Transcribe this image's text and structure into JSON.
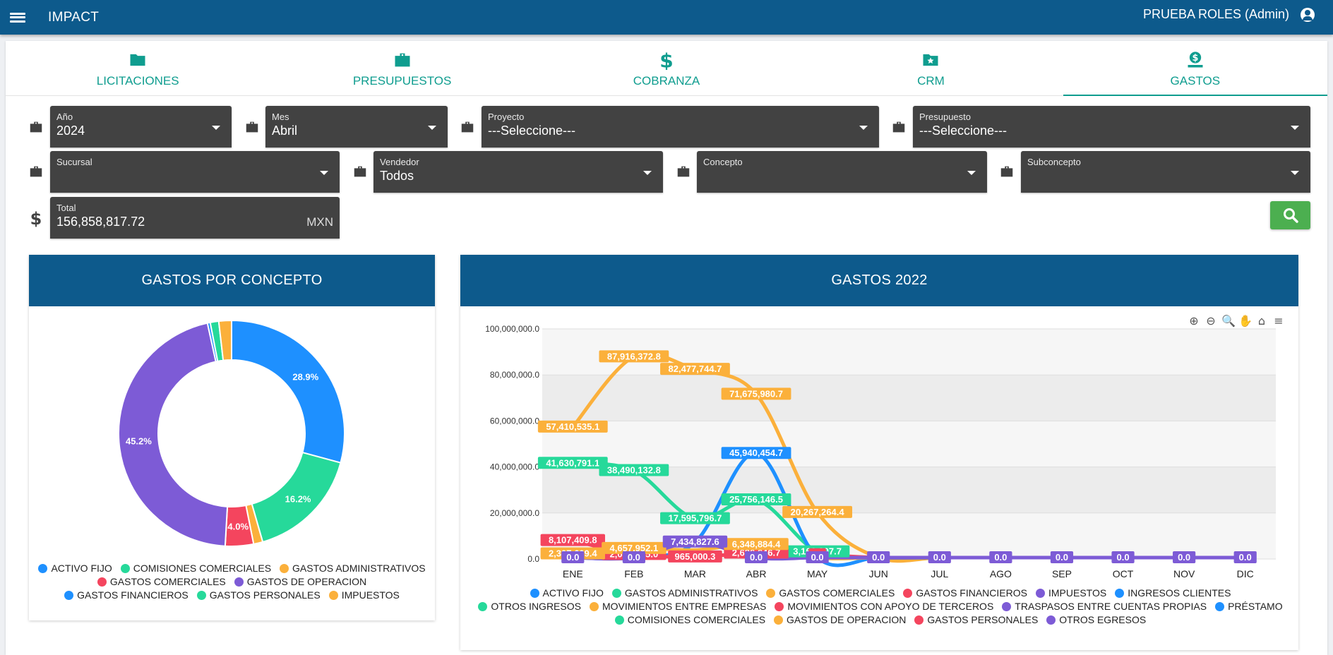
{
  "header": {
    "app_title": "IMPACT",
    "user": "PRUEBA ROLES (Admin)"
  },
  "tabs": [
    {
      "label": "LICITACIONES",
      "icon": "folder-icon"
    },
    {
      "label": "PRESUPUESTOS",
      "icon": "briefcase-icon"
    },
    {
      "label": "COBRANZA",
      "icon": "dollar-icon"
    },
    {
      "label": "CRM",
      "icon": "folder-star-icon"
    },
    {
      "label": "GASTOS",
      "icon": "hand-money-icon"
    }
  ],
  "filters": {
    "anio": {
      "label": "Año",
      "value": "2024"
    },
    "mes": {
      "label": "Mes",
      "value": "Abril"
    },
    "proyecto": {
      "label": "Proyecto",
      "value": "---Seleccione---"
    },
    "presupuesto": {
      "label": "Presupuesto",
      "value": "---Seleccione---"
    },
    "sucursal": {
      "label": "Sucursal",
      "value": ""
    },
    "vendedor": {
      "label": "Vendedor",
      "value": "Todos"
    },
    "concepto": {
      "label": "Concepto",
      "value": ""
    },
    "subconcepto": {
      "label": "Subconcepto",
      "value": ""
    },
    "total": {
      "label": "Total",
      "value": "156,858,817.72",
      "suffix": "MXN"
    }
  },
  "colors": {
    "header": "#0d5a8c",
    "accent": "#0f9d8f",
    "search": "#4caf50"
  },
  "donut": {
    "title": "GASTOS POR CONCEPTO",
    "legend": [
      {
        "name": "ACTIVO FIJO",
        "color": "#1e90ff"
      },
      {
        "name": "COMISIONES COMERCIALES",
        "color": "#26d99a"
      },
      {
        "name": "GASTOS ADMINISTRATIVOS",
        "color": "#fbb03b"
      },
      {
        "name": "GASTOS COMERCIALES",
        "color": "#f4455e"
      },
      {
        "name": "GASTOS DE OPERACION",
        "color": "#7d5bd6"
      },
      {
        "name": "GASTOS FINANCIEROS",
        "color": "#1e90ff"
      },
      {
        "name": "GASTOS PERSONALES",
        "color": "#26d99a"
      },
      {
        "name": "IMPUESTOS",
        "color": "#fbb03b"
      }
    ]
  },
  "line_chart": {
    "title": "GASTOS 2022",
    "toolbar": [
      "zoom-in-icon",
      "zoom-out-icon",
      "magnifier-icon",
      "pan-hand-icon",
      "home-icon",
      "menu-icon"
    ],
    "legend": [
      {
        "name": "ACTIVO FIJO",
        "color": "#1e90ff"
      },
      {
        "name": "GASTOS ADMINISTRATIVOS",
        "color": "#26d99a"
      },
      {
        "name": "GASTOS COMERCIALES",
        "color": "#fbb03b"
      },
      {
        "name": "GASTOS FINANCIEROS",
        "color": "#f4455e"
      },
      {
        "name": "IMPUESTOS",
        "color": "#7d5bd6"
      },
      {
        "name": "INGRESOS CLIENTES",
        "color": "#1e90ff"
      },
      {
        "name": "OTROS INGRESOS",
        "color": "#26d99a"
      },
      {
        "name": "MOVIMIENTOS ENTRE EMPRESAS",
        "color": "#fbb03b"
      },
      {
        "name": "MOVIMIENTOS CON APOYO DE TERCEROS",
        "color": "#f4455e"
      },
      {
        "name": "TRASPASOS ENTRE CUENTAS PROPIAS",
        "color": "#7d5bd6"
      },
      {
        "name": "PRÉSTAMO",
        "color": "#1e90ff"
      },
      {
        "name": "COMISIONES COMERCIALES",
        "color": "#26d99a"
      },
      {
        "name": "GASTOS DE OPERACION",
        "color": "#fbb03b"
      },
      {
        "name": "GASTOS PERSONALES",
        "color": "#f4455e"
      },
      {
        "name": "OTROS EGRESOS",
        "color": "#7d5bd6"
      }
    ]
  },
  "chart_data": [
    {
      "type": "pie",
      "title": "GASTOS POR CONCEPTO",
      "categories": [
        "ACTIVO FIJO",
        "COMISIONES COMERCIALES",
        "GASTOS ADMINISTRATIVOS",
        "GASTOS COMERCIALES",
        "GASTOS DE OPERACION",
        "GASTOS FINANCIEROS",
        "GASTOS PERSONALES",
        "IMPUESTOS"
      ],
      "values": [
        28.9,
        16.2,
        1.3,
        4.0,
        45.2,
        0.4,
        1.2,
        1.8
      ],
      "labels": [
        "28.9%",
        "16.2%",
        "",
        "4.0%",
        "45.2%",
        "",
        "",
        ""
      ],
      "colors": [
        "#1e90ff",
        "#26d99a",
        "#fbb03b",
        "#f4455e",
        "#7d5bd6",
        "#1e90ff",
        "#26d99a",
        "#fbb03b"
      ],
      "legend": "bottom"
    },
    {
      "type": "line",
      "title": "GASTOS 2022",
      "categories": [
        "ENE",
        "FEB",
        "MAR",
        "ABR",
        "MAY",
        "JUN",
        "JUL",
        "AGO",
        "SEP",
        "OCT",
        "NOV",
        "DIC"
      ],
      "ylim": [
        0,
        100000000
      ],
      "yticks": [
        "0.0",
        "20,000,000.0",
        "40,000,000.0",
        "60,000,000.0",
        "80,000,000.0",
        "100,000,000.0"
      ],
      "series": [
        {
          "name": "GASTOS DE OPERACION",
          "color": "#fbb03b",
          "values": [
            57410535.1,
            87916372.8,
            82477744.7,
            71675980.7,
            20267264.4,
            0,
            0,
            0,
            0,
            0,
            0,
            0
          ],
          "labels": [
            "57,410,535.1",
            "87,916,372.8",
            "82,477,744.7",
            "71,675,980.7",
            "20,267,264.4",
            "",
            "",
            "",
            "",
            "",
            "",
            ""
          ]
        },
        {
          "name": "COMISIONES COMERCIALES",
          "color": "#26d99a",
          "values": [
            41630791.1,
            38490132.8,
            17595796.7,
            25756146.5,
            3169297.7,
            0,
            0,
            0,
            0,
            0,
            0,
            0
          ],
          "labels": [
            "41,630,791.1",
            "38,490,132.8",
            "17,595,796.7",
            "25,756,146.5",
            "3,169,297.7",
            "",
            "",
            "",
            "",
            "",
            "",
            ""
          ]
        },
        {
          "name": "ACTIVO FIJO",
          "color": "#1e90ff",
          "values": [
            0,
            0,
            7300000,
            45940454.7,
            0,
            0,
            0,
            0,
            0,
            0,
            0,
            0
          ],
          "labels": [
            "",
            "",
            "",
            "45,940,454.7",
            "",
            "",
            "",
            "",
            "",
            "",
            "",
            ""
          ]
        },
        {
          "name": "GASTOS PERSONALES",
          "color": "#f4455e",
          "values": [
            8107409.8,
            2041785.0,
            965000,
            2626646.7,
            1900000,
            0,
            0,
            0,
            0,
            0,
            0,
            0
          ],
          "labels": [
            "8,107,409.8",
            "2,041,785.0",
            "965,000.3",
            "2,626,646.7",
            "19",
            "",
            "",
            "",
            "",
            "",
            "",
            ""
          ]
        },
        {
          "name": "GASTOS ADMINISTRATIVOS",
          "color": "#fbb03b",
          "values": [
            2300000,
            4657952.1,
            3900000,
            6348884.4,
            0,
            0,
            0,
            0,
            0,
            0,
            0,
            0
          ],
          "labels": [
            "2,307,609.4",
            "4,657,952.1",
            "",
            "6,348,884.4",
            "",
            "",
            "",
            "",
            "",
            "",
            "",
            ""
          ]
        },
        {
          "name": "IMPUESTOS",
          "color": "#7d5bd6",
          "values": [
            0,
            0,
            7434827.6,
            0,
            0,
            0,
            0,
            0,
            0,
            0,
            0,
            0
          ],
          "labels": [
            "0.0",
            "0.0",
            "7,434,827.6",
            "0.0",
            "0.0",
            "0.0",
            "0.0",
            "0.0",
            "0.0",
            "0.0",
            "0.0",
            "0.0"
          ]
        }
      ],
      "legend": "bottom"
    }
  ]
}
